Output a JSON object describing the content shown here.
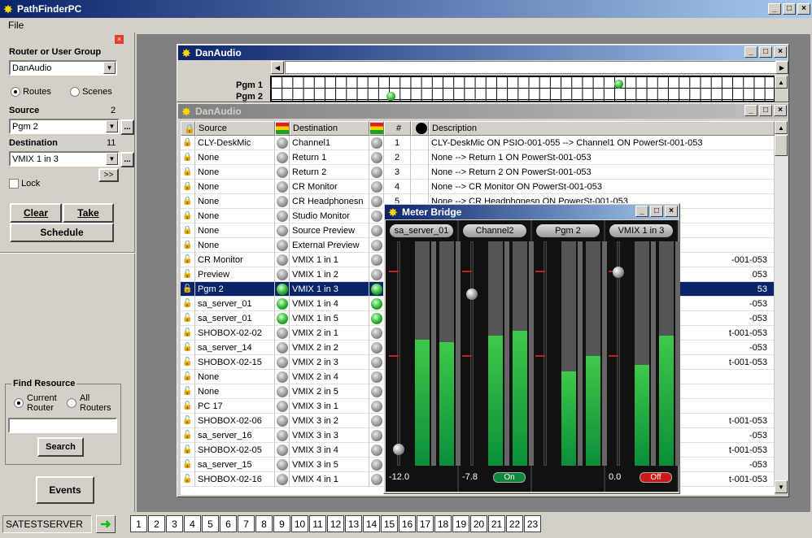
{
  "app": {
    "title": "PathFinderPC",
    "menu_file": "File"
  },
  "left": {
    "router_label": "Router or User Group",
    "router_value": "DanAudio",
    "routes": "Routes",
    "scenes": "Scenes",
    "source_label": "Source",
    "source_num": "2",
    "source_value": "Pgm 2",
    "dest_label": "Destination",
    "dest_num": "11",
    "dest_value": "VMIX 1 in 3",
    "more": "...",
    "dbl": ">>",
    "lock": "Lock",
    "clear": "Clear",
    "take": "Take",
    "schedule": "Schedule",
    "find_title": "Find Resource",
    "current": "Current",
    "router": "Router",
    "all": "All",
    "routers": "Routers",
    "search": "Search",
    "events": "Events"
  },
  "xy": {
    "title": "DanAudio",
    "rows": [
      "Pgm 1",
      "Pgm 2"
    ]
  },
  "list": {
    "title": "DanAudio",
    "headers": {
      "source": "Source",
      "dest": "Destination",
      "num": "#",
      "desc": "Description"
    },
    "rows": [
      {
        "s": "CLY-DeskMic",
        "d": "Channel1",
        "n": "1",
        "desc": "CLY-DeskMic ON PSIO-001-055 --> Channel1 ON PowerSt-001-053"
      },
      {
        "s": "None",
        "d": "Return 1",
        "n": "2",
        "desc": "None --> Return 1 ON PowerSt-001-053"
      },
      {
        "s": "None",
        "d": "Return 2",
        "n": "3",
        "desc": "None --> Return 2 ON PowerSt-001-053"
      },
      {
        "s": "None",
        "d": "CR Monitor",
        "n": "4",
        "desc": "None --> CR Monitor ON PowerSt-001-053"
      },
      {
        "s": "None",
        "d": "CR Headphonesn",
        "n": "5",
        "desc": "None --> CR Headphonesn ON PowerSt-001-053"
      },
      {
        "s": "None",
        "d": "Studio Monitor",
        "n": "",
        "desc": ""
      },
      {
        "s": "None",
        "d": "Source Preview",
        "n": "",
        "desc": ""
      },
      {
        "s": "None",
        "d": "External Preview",
        "n": "",
        "desc": ""
      },
      {
        "s": "CR Monitor",
        "d": "VMIX 1 in 1",
        "n": "",
        "desc": "-001-053"
      },
      {
        "s": "Preview",
        "d": "VMIX 1 in 2",
        "n": "",
        "desc": "053"
      },
      {
        "s": "Pgm 2",
        "d": "VMIX 1 in 3",
        "n": "",
        "desc": "53"
      },
      {
        "s": "sa_server_01",
        "d": "VMIX 1 in 4",
        "n": "",
        "desc": "-053"
      },
      {
        "s": "sa_server_01",
        "d": "VMIX 1 in 5",
        "n": "",
        "desc": "-053"
      },
      {
        "s": "SHOBOX-02-02",
        "d": "VMIX 2 in 1",
        "n": "",
        "desc": "t-001-053"
      },
      {
        "s": "sa_server_14",
        "d": "VMIX 2 in 2",
        "n": "",
        "desc": "-053"
      },
      {
        "s": "SHOBOX-02-15",
        "d": "VMIX 2 in 3",
        "n": "",
        "desc": "t-001-053"
      },
      {
        "s": "None",
        "d": "VMIX 2 in 4",
        "n": "",
        "desc": ""
      },
      {
        "s": "None",
        "d": "VMIX 2 in 5",
        "n": "",
        "desc": ""
      },
      {
        "s": "PC 17",
        "d": "VMIX 3 in 1",
        "n": "",
        "desc": ""
      },
      {
        "s": "SHOBOX-02-06",
        "d": "VMIX 3 in 2",
        "n": "",
        "desc": "t-001-053"
      },
      {
        "s": "sa_server_16",
        "d": "VMIX 3 in 3",
        "n": "",
        "desc": "-053"
      },
      {
        "s": "SHOBOX-02-05",
        "d": "VMIX 3 in 4",
        "n": "",
        "desc": "t-001-053"
      },
      {
        "s": "sa_server_15",
        "d": "VMIX 3 in 5",
        "n": "",
        "desc": "-053"
      },
      {
        "s": "SHOBOX-02-16",
        "d": "VMIX 4 in 1",
        "n": "",
        "desc": "t-001-053"
      }
    ]
  },
  "meter": {
    "title": "Meter Bridge",
    "channels": [
      {
        "name": "sa_server_01",
        "value": "-12.0",
        "l": 0.56,
        "r": 0.55,
        "fader": 0.05,
        "btn": ""
      },
      {
        "name": "Channel2",
        "value": "-7.8",
        "l": 0.58,
        "r": 0.6,
        "fader": 0.78,
        "btn": "On"
      },
      {
        "name": "Pgm 2",
        "value": "",
        "l": 0.42,
        "r": 0.49,
        "fader": 0,
        "btn": ""
      },
      {
        "name": "VMIX 1 in 3",
        "value": "0.0",
        "l": 0.45,
        "r": 0.58,
        "fader": 0.88,
        "btn": "Off"
      }
    ],
    "scale": [
      "0",
      "10",
      "20",
      "30",
      "40",
      "50",
      "60"
    ]
  },
  "status": {
    "server": "SATESTSERVER",
    "tabs": [
      "1",
      "2",
      "3",
      "4",
      "5",
      "6",
      "7",
      "8",
      "9",
      "10",
      "11",
      "12",
      "13",
      "14",
      "15",
      "16",
      "17",
      "18",
      "19",
      "20",
      "21",
      "22",
      "23"
    ]
  }
}
